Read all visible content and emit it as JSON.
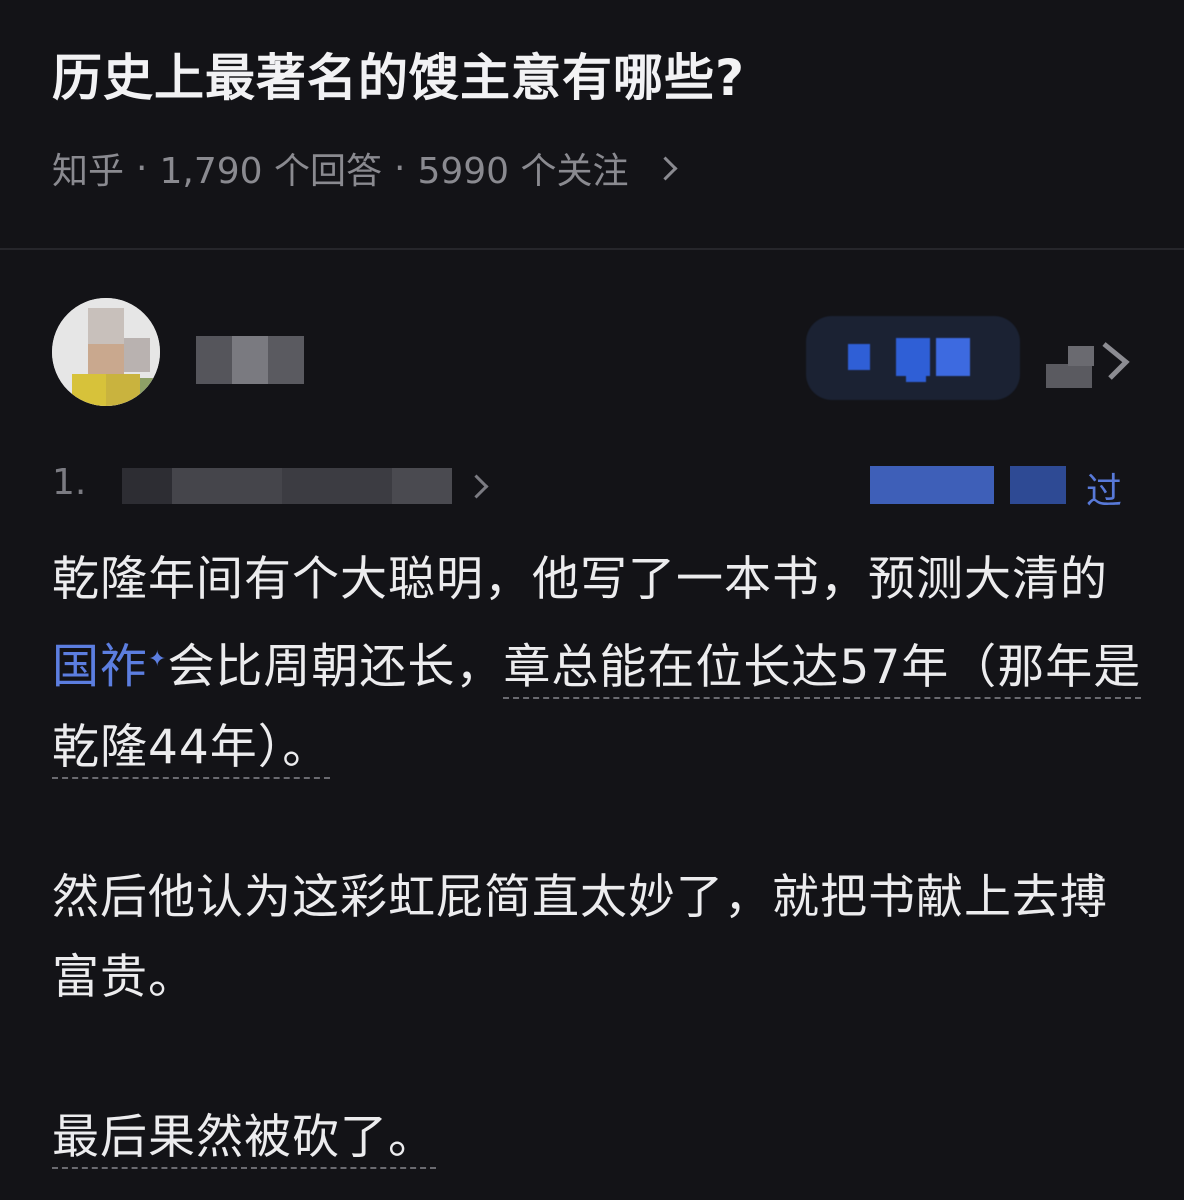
{
  "question": {
    "title": "历史上最著名的馊主意有哪些?",
    "source": "知乎",
    "sep": "·",
    "answers": "1,790 个回答",
    "followers": "5990 个关注"
  },
  "answer": {
    "meta_count": "1.",
    "edited_label": "过",
    "para1_a": "乾隆年间有个大聪明，他写了一本书，预测大清的",
    "para1_link": "国祚",
    "para1_sparkle": "✦",
    "para1_b": "会比周朝还长，",
    "para1_c": "章总能在位长达57年（那年是乾隆44年）。",
    "para2": "然后他认为这彩虹屁简直太妙了，就把书献上去搏富贵。",
    "para3": "最后果然被砍了。"
  },
  "icons": {
    "chevron": "chevron-right-icon",
    "share": "share-icon"
  },
  "colors": {
    "background": "#131317",
    "text": "#ececee",
    "meta": "#8a8a90",
    "link": "#5c7ee0"
  }
}
